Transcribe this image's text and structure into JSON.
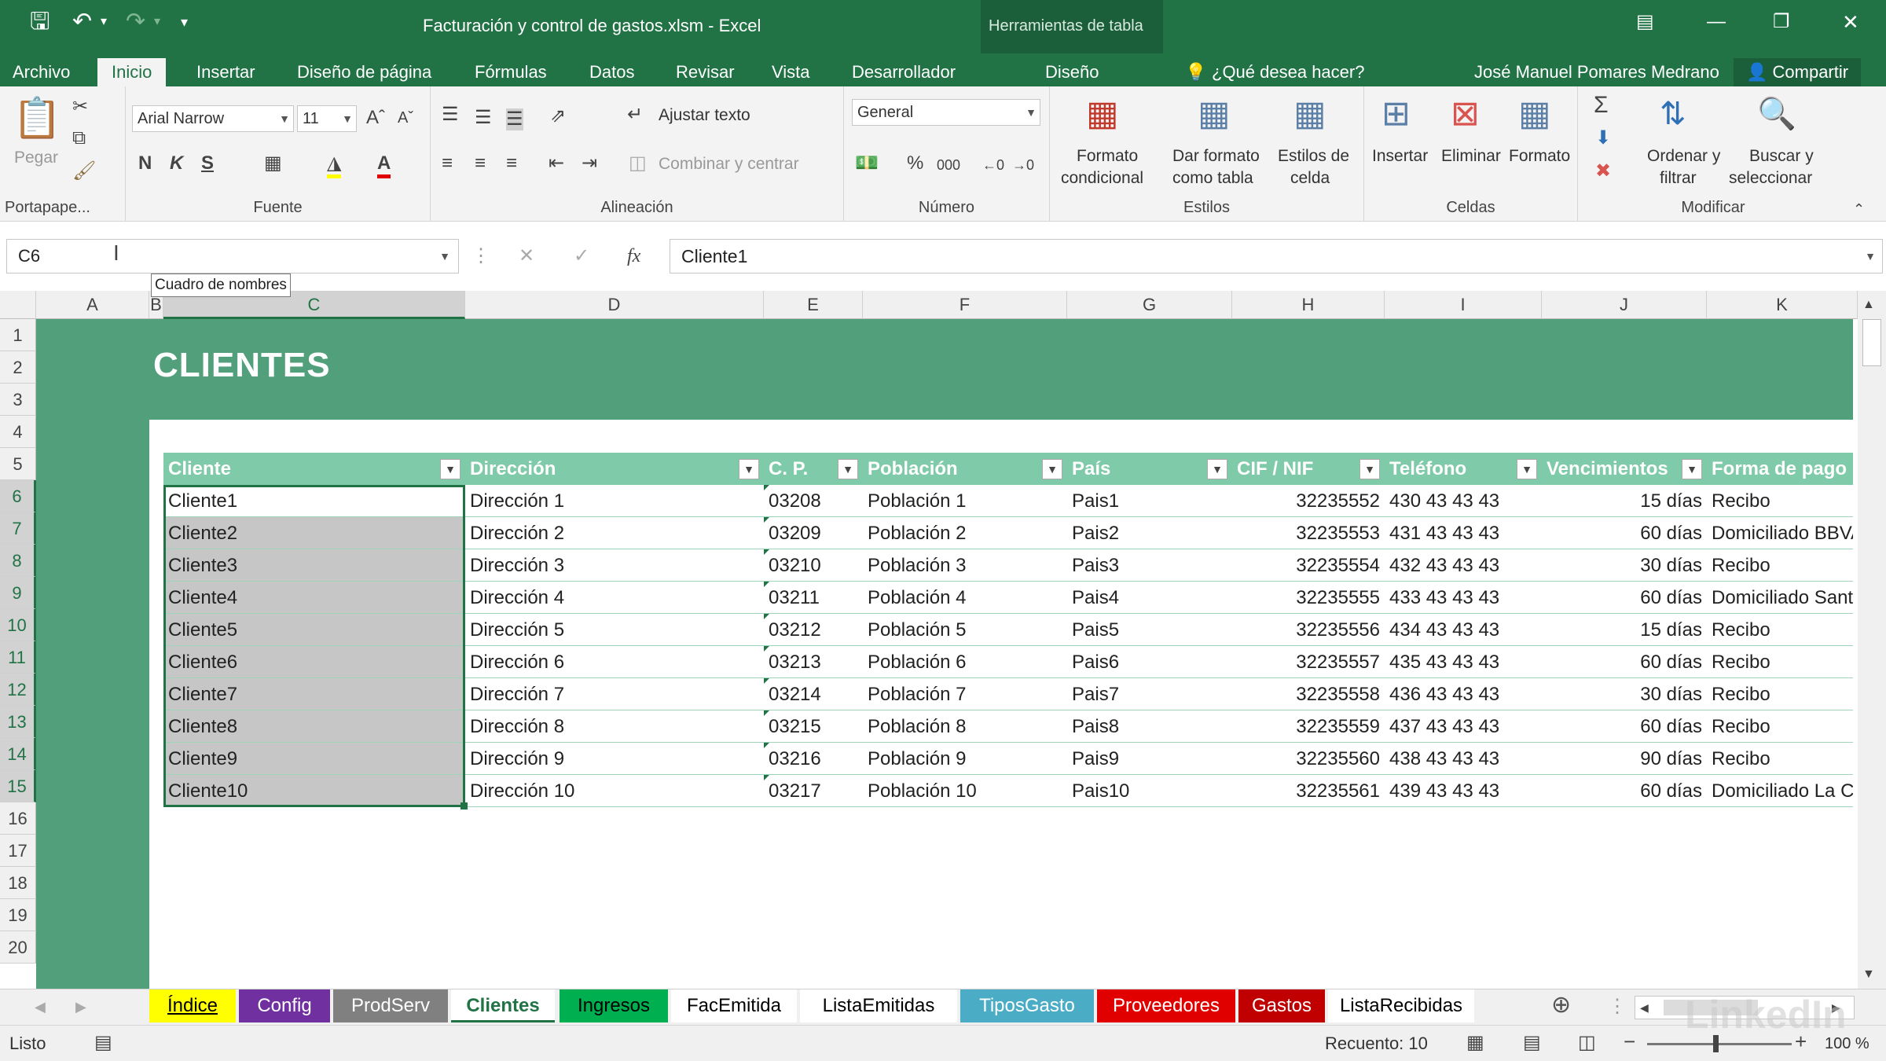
{
  "window": {
    "title": "Facturación y control de gastos.xlsm - Excel",
    "context_tools_label": "Herramientas de tabla",
    "user_name": "José Manuel Pomares Medrano",
    "share_label": "Compartir",
    "search_placeholder": "¿Qué desea hacer?"
  },
  "ribbon_tabs": [
    "Archivo",
    "Inicio",
    "Insertar",
    "Diseño de página",
    "Fórmulas",
    "Datos",
    "Revisar",
    "Vista",
    "Desarrollador",
    "Diseño"
  ],
  "active_tab": "Inicio",
  "ribbon": {
    "clipboard": {
      "paste": "Pegar",
      "label": "Portapape..."
    },
    "font": {
      "name": "Arial Narrow",
      "size": "11",
      "bold": "N",
      "italic": "K",
      "underline": "S",
      "label": "Fuente"
    },
    "alignment": {
      "wrap": "Ajustar texto",
      "merge": "Combinar y centrar",
      "label": "Alineación"
    },
    "number": {
      "format": "General",
      "percent": "%",
      "thousands": "000",
      "label": "Número"
    },
    "styles": {
      "conditional_l1": "Formato",
      "conditional_l2": "condicional",
      "as_table_l1": "Dar formato",
      "as_table_l2": "como tabla",
      "cell_styles_l1": "Estilos de",
      "cell_styles_l2": "celda",
      "label": "Estilos"
    },
    "cells": {
      "insert": "Insertar",
      "delete": "Eliminar",
      "format": "Formato",
      "label": "Celdas"
    },
    "editing": {
      "sort_l1": "Ordenar y",
      "sort_l2": "filtrar",
      "find_l1": "Buscar y",
      "find_l2": "seleccionar",
      "label": "Modificar"
    }
  },
  "formula_bar": {
    "name_box": "C6",
    "fx": "fx",
    "value": "Cliente1",
    "tooltip": "Cuadro de nombres"
  },
  "columns": [
    "A",
    "B",
    "C",
    "D",
    "E",
    "F",
    "G",
    "H",
    "I",
    "J",
    "K"
  ],
  "selected_column": "C",
  "rows": [
    "1",
    "2",
    "3",
    "4",
    "5",
    "6",
    "7",
    "8",
    "9",
    "10",
    "11",
    "12",
    "13",
    "14",
    "15",
    "16",
    "17",
    "18",
    "19",
    "20"
  ],
  "selected_rows": [
    "6",
    "7",
    "8",
    "9",
    "10",
    "11",
    "12",
    "13",
    "14",
    "15"
  ],
  "sheet": {
    "title": "CLIENTES",
    "headers": [
      "Cliente",
      "Dirección",
      "C. P.",
      "Población",
      "País",
      "CIF / NIF",
      "Teléfono",
      "Vencimientos",
      "Forma de pago"
    ],
    "table_rows": [
      [
        "Cliente1",
        "Dirección 1",
        "03208",
        "Población 1",
        "Pais1",
        "32235552",
        "430 43 43 43",
        "15 días",
        "Recibo"
      ],
      [
        "Cliente2",
        "Dirección 2",
        "03209",
        "Población 2",
        "Pais2",
        "32235553",
        "431 43 43 43",
        "60 días",
        "Domiciliado BBVA"
      ],
      [
        "Cliente3",
        "Dirección 3",
        "03210",
        "Población 3",
        "Pais3",
        "32235554",
        "432 43 43 43",
        "30 días",
        "Recibo"
      ],
      [
        "Cliente4",
        "Dirección 4",
        "03211",
        "Población 4",
        "Pais4",
        "32235555",
        "433 43 43 43",
        "60 días",
        "Domiciliado Santander"
      ],
      [
        "Cliente5",
        "Dirección 5",
        "03212",
        "Población 5",
        "Pais5",
        "32235556",
        "434 43 43 43",
        "15 días",
        "Recibo"
      ],
      [
        "Cliente6",
        "Dirección 6",
        "03213",
        "Población 6",
        "Pais6",
        "32235557",
        "435 43 43 43",
        "60 días",
        "Recibo"
      ],
      [
        "Cliente7",
        "Dirección 7",
        "03214",
        "Población 7",
        "Pais7",
        "32235558",
        "436 43 43 43",
        "30 días",
        "Recibo"
      ],
      [
        "Cliente8",
        "Dirección 8",
        "03215",
        "Población 8",
        "Pais8",
        "32235559",
        "437 43 43 43",
        "60 días",
        "Recibo"
      ],
      [
        "Cliente9",
        "Dirección 9",
        "03216",
        "Población 9",
        "Pais9",
        "32235560",
        "438 43 43 43",
        "90 días",
        "Recibo"
      ],
      [
        "Cliente10",
        "Dirección 10",
        "03217",
        "Población 10",
        "Pais10",
        "32235561",
        "439 43 43 43",
        "60 días",
        "Domiciliado La Caixa"
      ]
    ]
  },
  "sheet_tabs": [
    {
      "name": "Índice",
      "bg": "#ffff00",
      "fg": "#000000"
    },
    {
      "name": "Config",
      "bg": "#7030a0",
      "fg": "#ffffff"
    },
    {
      "name": "ProdServ",
      "bg": "#808080",
      "fg": "#ffffff"
    },
    {
      "name": "Clientes",
      "bg": "#ffffff",
      "fg": "#217346"
    },
    {
      "name": "Ingresos",
      "bg": "#00b050",
      "fg": "#000000"
    },
    {
      "name": "FacEmitida",
      "bg": "#ffffff",
      "fg": "#000000"
    },
    {
      "name": "ListaEmitidas",
      "bg": "#ffffff",
      "fg": "#000000"
    },
    {
      "name": "TiposGasto",
      "bg": "#4bacc6",
      "fg": "#ffffff"
    },
    {
      "name": "Proveedores",
      "bg": "#e00000",
      "fg": "#ffffff"
    },
    {
      "name": "Gastos",
      "bg": "#c00000",
      "fg": "#ffffff"
    },
    {
      "name": "ListaRecibidas",
      "bg": "#ffffff",
      "fg": "#000000"
    }
  ],
  "active_sheet": "Clientes",
  "status": {
    "ready": "Listo",
    "count": "Recuento: 10",
    "zoom": "100 %"
  },
  "watermark": "LinkedIn",
  "colors": {
    "excel_green": "#217346",
    "table_header": "#7fcaa8",
    "sheet_bg": "#52a07b"
  }
}
